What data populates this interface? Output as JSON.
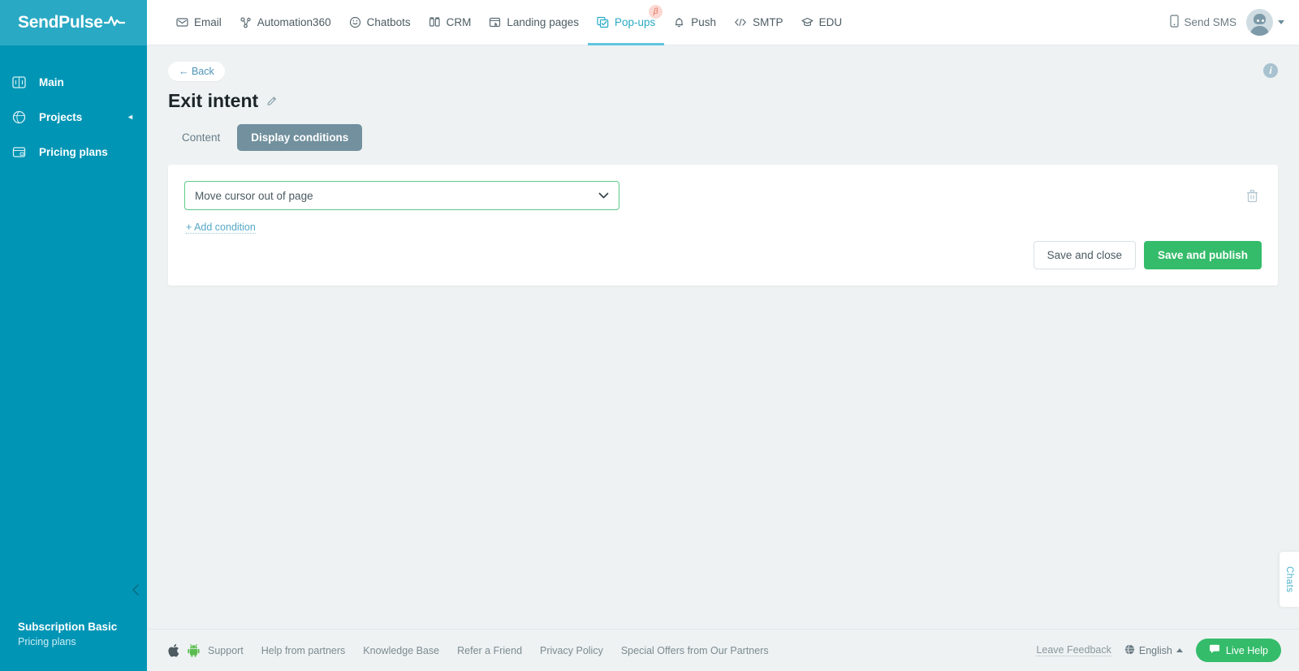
{
  "brand": {
    "logo_text": "SendPulse",
    "logo_icon": "pulse-wave-icon",
    "accent_teal": "#0095b5",
    "logo_bar": "#2aa9c4",
    "accent_green": "#35bc6b",
    "active_tab_bg": "#72909e",
    "select_border": "#5dcb8a"
  },
  "sidebar": {
    "items": [
      {
        "label": "Main",
        "icon": "dashboard-icon"
      },
      {
        "label": "Projects",
        "icon": "globe-icon",
        "chevron": "◂"
      },
      {
        "label": "Pricing plans",
        "icon": "wallet-icon"
      }
    ],
    "subscription": {
      "title": "Subscription Basic",
      "link": "Pricing plans"
    },
    "collapse_icon": "chevron-left-icon"
  },
  "topnav": {
    "items": [
      {
        "label": "Email",
        "icon": "envelope-icon",
        "active": false
      },
      {
        "label": "Automation360",
        "icon": "flow-icon",
        "active": false
      },
      {
        "label": "Chatbots",
        "icon": "chat-smile-icon",
        "active": false
      },
      {
        "label": "CRM",
        "icon": "columns-icon",
        "active": false
      },
      {
        "label": "Landing pages",
        "icon": "landing-icon",
        "active": false
      },
      {
        "label": "Pop-ups",
        "icon": "popup-icon",
        "active": true,
        "badge": "β"
      },
      {
        "label": "Push",
        "icon": "bell-icon",
        "active": false
      },
      {
        "label": "SMTP",
        "icon": "code-icon",
        "active": false
      },
      {
        "label": "EDU",
        "icon": "graduation-icon",
        "active": false
      }
    ],
    "send_sms": {
      "label": "Send SMS",
      "icon": "phone-icon"
    },
    "avatar": {
      "icon": "user-avatar",
      "caret": "chevron-down-icon"
    }
  },
  "page": {
    "back_label": "← Back",
    "title": "Exit intent",
    "edit_icon": "pencil-icon",
    "info_icon": "info-icon",
    "info_char": "i",
    "tabs": [
      {
        "label": "Content",
        "active": false
      },
      {
        "label": "Display conditions",
        "active": true
      }
    ]
  },
  "card": {
    "condition": {
      "value": "Move cursor out of page",
      "chevron": "chevron-down-icon",
      "delete_icon": "trash-icon"
    },
    "add_condition_label": "+ Add condition",
    "buttons": {
      "save_close": "Save and close",
      "save_publish": "Save and publish"
    }
  },
  "footer": {
    "store_icons": [
      {
        "name": "apple-icon"
      },
      {
        "name": "android-icon"
      }
    ],
    "links": [
      "Support",
      "Help from partners",
      "Knowledge Base",
      "Refer a Friend",
      "Privacy Policy",
      "Special Offers from Our Partners"
    ],
    "feedback": "Leave Feedback",
    "language": {
      "label": "English",
      "icon": "globe-icon",
      "caret": "caret-up-icon"
    },
    "live_help": {
      "label": "Live Help",
      "icon": "chat-bubble-icon"
    }
  },
  "chats_tab": {
    "label": "Chats"
  }
}
